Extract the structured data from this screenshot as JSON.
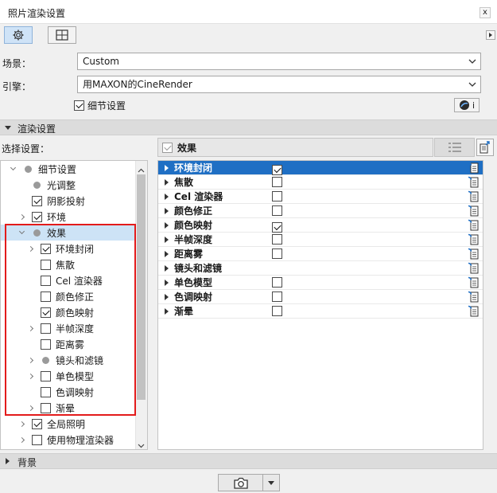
{
  "window": {
    "title": "照片渲染设置",
    "close_glyph": "x"
  },
  "form": {
    "scene_label": "场景：",
    "scene_value": "Custom",
    "engine_label": "引擎：",
    "engine_value": "用MAXON的CineRender",
    "detail_label": "细节设置",
    "detail_checked": true,
    "info_button_label": "i"
  },
  "render_section": {
    "title": "渲染设置"
  },
  "select_label": "选择设置：",
  "panel_header": {
    "label": "效果",
    "checked": true
  },
  "tree": [
    {
      "label": "细节设置",
      "expand": "down",
      "marker": "dot"
    },
    {
      "label": "光调整",
      "expand": "none",
      "marker": "dot"
    },
    {
      "label": "阴影投射",
      "expand": "none",
      "marker": "checkbox",
      "checked": true
    },
    {
      "label": "环境",
      "expand": "right",
      "marker": "checkbox",
      "checked": true
    },
    {
      "label": "效果",
      "expand": "down",
      "marker": "dot",
      "selected": true
    },
    {
      "label": "环境封闭",
      "expand": "right",
      "marker": "checkbox",
      "checked": true
    },
    {
      "label": "焦散",
      "expand": "none",
      "marker": "checkbox",
      "checked": false
    },
    {
      "label": "Cel 渲染器",
      "expand": "none",
      "marker": "checkbox",
      "checked": false
    },
    {
      "label": "颜色修正",
      "expand": "none",
      "marker": "checkbox",
      "checked": false
    },
    {
      "label": "颜色映射",
      "expand": "none",
      "marker": "checkbox",
      "checked": true
    },
    {
      "label": "半帧深度",
      "expand": "right",
      "marker": "checkbox",
      "checked": false
    },
    {
      "label": "距离雾",
      "expand": "none",
      "marker": "checkbox",
      "checked": false
    },
    {
      "label": "镜头和滤镜",
      "expand": "right",
      "marker": "dot"
    },
    {
      "label": "单色模型",
      "expand": "right",
      "marker": "checkbox",
      "checked": false
    },
    {
      "label": "色调映射",
      "expand": "none",
      "marker": "checkbox",
      "checked": false
    },
    {
      "label": "渐晕",
      "expand": "right",
      "marker": "checkbox",
      "checked": false
    },
    {
      "label": "全局照明",
      "expand": "right",
      "marker": "checkbox",
      "checked": true
    },
    {
      "label": "使用物理渲染器",
      "expand": "right",
      "marker": "checkbox",
      "checked": false
    }
  ],
  "effects": [
    {
      "label": "环境封闭",
      "checked": true,
      "selected": true
    },
    {
      "label": "焦散",
      "checked": false
    },
    {
      "label": "Cel 渲染器",
      "checked": false
    },
    {
      "label": "颜色修正",
      "checked": false
    },
    {
      "label": "颜色映射",
      "checked": true
    },
    {
      "label": "半帧深度",
      "checked": false
    },
    {
      "label": "距离雾",
      "checked": false
    },
    {
      "label": "镜头和滤镜",
      "has_checkbox": false
    },
    {
      "label": "单色模型",
      "checked": false
    },
    {
      "label": "色调映射",
      "checked": false
    },
    {
      "label": "渐晕",
      "checked": false
    }
  ],
  "background_section": {
    "title": "背景"
  },
  "colors": {
    "selection": "#1f6fc4",
    "highlight_box": "#e31b1b",
    "tree_selection": "#cde3f6"
  }
}
